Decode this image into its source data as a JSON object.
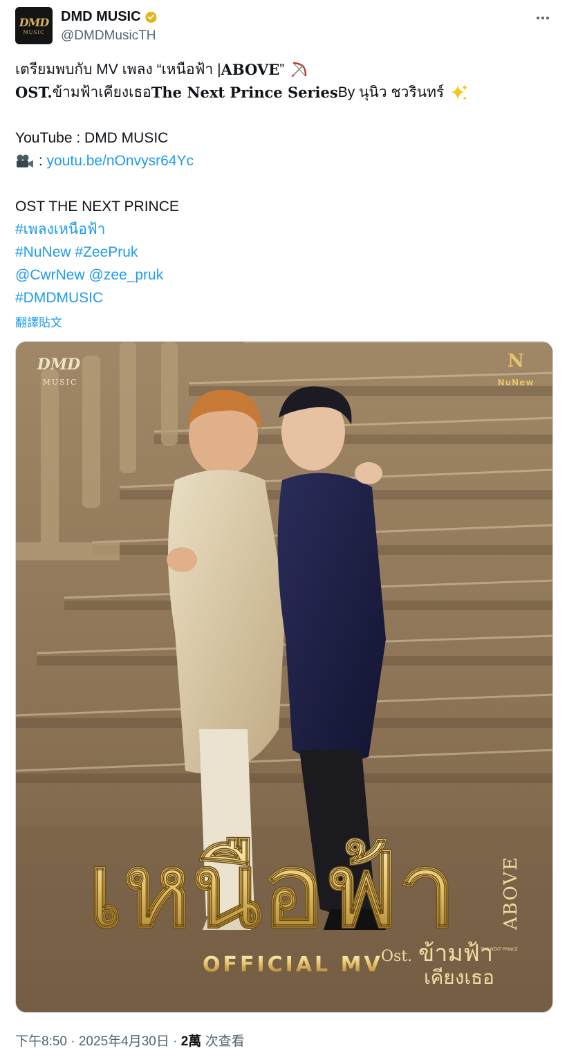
{
  "author": {
    "display_name": "DMD MUSIC",
    "handle": "@DMDMusicTH",
    "avatar_text_top": "DMD",
    "avatar_text_bottom": "MUSIC"
  },
  "icons": {
    "verified": "verified-badge-icon",
    "more": "more-options-icon",
    "bow_arrow": "bow-and-arrow-emoji",
    "sparkles": "sparkles-emoji",
    "camera": "movie-camera-emoji"
  },
  "tweet": {
    "line1_a": "เตรียมพบกับ MV เพลง “เหนือฟ้า | ",
    "line1_b": "ABOVE",
    "line1_c": "”",
    "line2_a": "OST.",
    "line2_b": " ข้ามฟ้าเคียงเธอ ",
    "line2_c": "The Next Prince Series",
    "line2_d": "  By นุนิว ชวรินทร์",
    "youtube_line": "YouTube : DMD MUSIC",
    "camera_prefix": " : ",
    "youtube_link": "youtu.be/nOnvysr64Yc",
    "ost_line": "OST THE NEXT PRINCE",
    "hashtag1": "#เพลงเหนือฟ้า",
    "hashtag2": "#NuNew",
    "hashtag3": "#ZeePruk",
    "mention1": "@CwrNew",
    "mention2": "@zee_pruk",
    "hashtag4": "#DMDMUSIC",
    "translate_label": "翻譯貼文"
  },
  "poster": {
    "label_logo_dmd": "DMD",
    "label_logo_music": "MUSIC",
    "label_logo_nunew": "NuNew",
    "title_thai": "เหนือฟ้า",
    "title_en": "ABOVE",
    "official_mv": "OFFICIAL MV",
    "ost_prefix": "Ost.",
    "ost_title_top": "ข้ามฟ้า",
    "ost_title_bottom": "เคียงเธอ",
    "ost_small": "THE NEXT PRINCE"
  },
  "meta": {
    "time": "下午8:50 · 2025年4月30日 · ",
    "views_count": "2萬",
    "views_label": " 次查看"
  },
  "colors": {
    "link": "#1d9bf0",
    "secondary_text": "#536471",
    "primary_text": "#0f1419",
    "verified_gold": "#e2b719",
    "poster_gold": "#e8c46a"
  }
}
